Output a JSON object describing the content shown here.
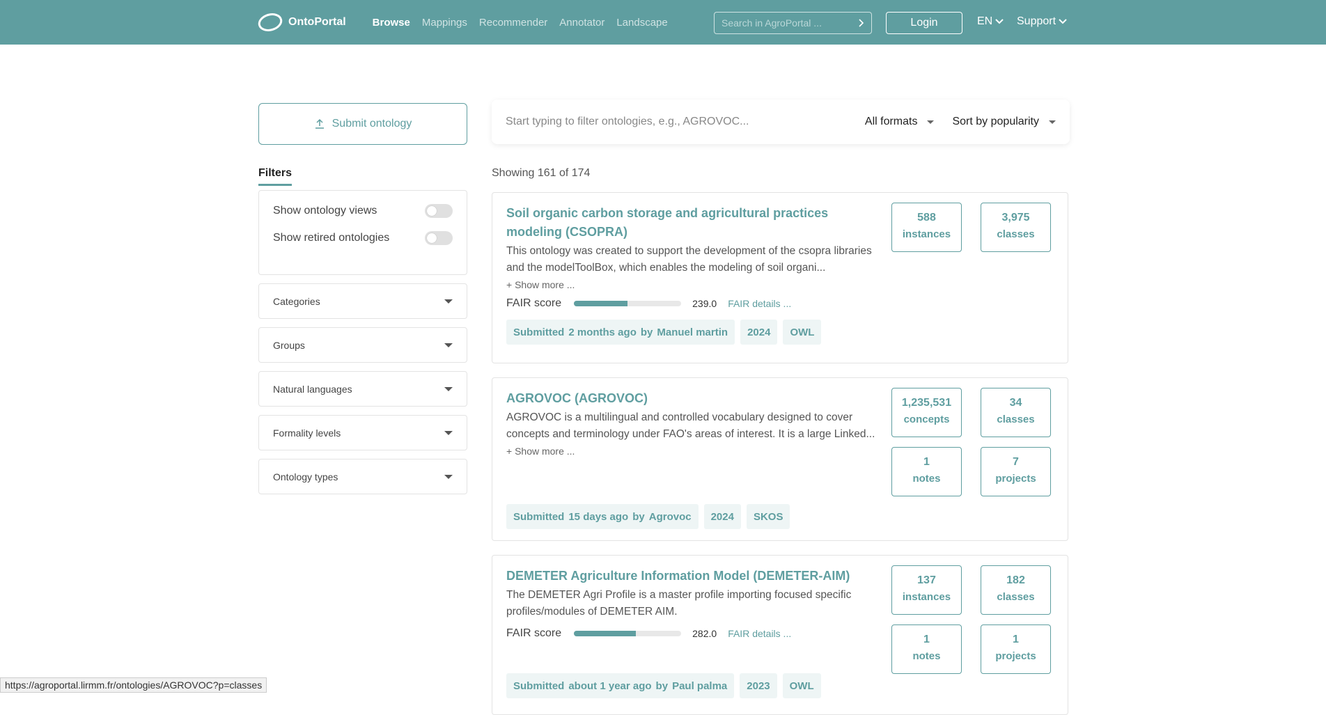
{
  "nav": {
    "brand": "OntoPortal",
    "links": [
      "Browse",
      "Mappings",
      "Recommender",
      "Annotator",
      "Landscape"
    ],
    "search_placeholder": "Search in AgroPortal ...",
    "login": "Login",
    "lang": "EN",
    "support": "Support"
  },
  "sidebar": {
    "submit_label": "Submit ontology",
    "filters_title": "Filters",
    "toggles": [
      "Show ontology views",
      "Show retired ontologies"
    ],
    "dropdowns": [
      "Categories",
      "Groups",
      "Natural languages",
      "Formality levels",
      "Ontology types"
    ]
  },
  "filterbar": {
    "placeholder": "Start typing to filter ontologies, e.g., AGROVOC...",
    "format": "All formats",
    "sort": "Sort by popularity"
  },
  "showing": "Showing 161 of 174",
  "cards": [
    {
      "title": "Soil organic carbon storage and agricultural practices modeling (CSOPRA)",
      "desc": "This ontology was created to support the development of the csopra libraries and the modelToolBox, which enables the modeling of soil organi...",
      "show_more": "+ Show more ...",
      "fair_label": "FAIR score",
      "fair_score": "239.0",
      "fair_fraction": 0.5,
      "fair_details": "FAIR details ...",
      "chips": {
        "submitted": "Submitted",
        "when": "2 months ago",
        "by": "by",
        "author": "Manuel martin",
        "year": "2024",
        "format": "OWL"
      },
      "stats": [
        {
          "n": "588",
          "l": "instances"
        },
        {
          "n": "3,975",
          "l": "classes"
        }
      ]
    },
    {
      "title": "AGROVOC (AGROVOC)",
      "desc": "AGROVOC is a multilingual and controlled vocabulary designed to cover concepts and terminology under FAO's areas of interest. It is a large Linked...",
      "show_more": "+ Show more ...",
      "chips": {
        "submitted": "Submitted",
        "when": "15 days ago",
        "by": "by",
        "author": "Agrovoc",
        "year": "2024",
        "format": "SKOS"
      },
      "stats": [
        {
          "n": "1,235,531",
          "l": "concepts"
        },
        {
          "n": "34",
          "l": "classes"
        },
        {
          "n": "1",
          "l": "notes"
        },
        {
          "n": "7",
          "l": "projects"
        }
      ]
    },
    {
      "title": "DEMETER Agriculture Information Model (DEMETER-AIM)",
      "desc": "The DEMETER Agri Profile is a master profile importing focused specific profiles/modules of DEMETER AIM.",
      "fair_label": "FAIR score",
      "fair_score": "282.0",
      "fair_fraction": 0.58,
      "fair_details": "FAIR details ...",
      "chips": {
        "submitted": "Submitted",
        "when": "about 1 year ago",
        "by": "by",
        "author": "Paul palma",
        "year": "2023",
        "format": "OWL"
      },
      "stats": [
        {
          "n": "137",
          "l": "instances"
        },
        {
          "n": "182",
          "l": "classes"
        },
        {
          "n": "1",
          "l": "notes"
        },
        {
          "n": "1",
          "l": "projects"
        }
      ]
    }
  ],
  "statusbar": "https://agroportal.lirmm.fr/ontologies/AGROVOC?p=classes"
}
